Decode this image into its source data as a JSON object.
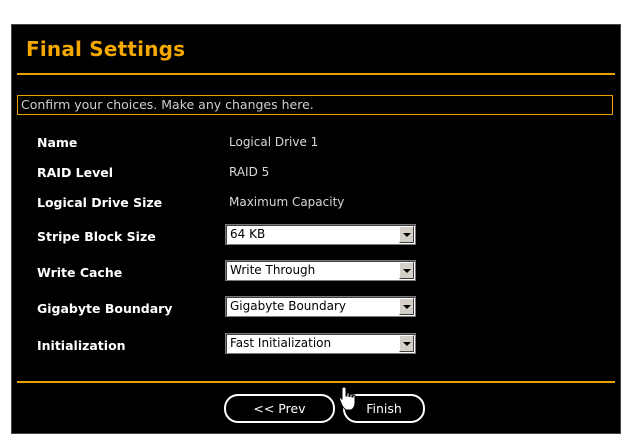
{
  "title": "Final Settings",
  "confirm_text": "Confirm your choices. Make any changes here.",
  "fields": {
    "name": {
      "label": "Name",
      "value": "Logical Drive 1"
    },
    "raid_level": {
      "label": "RAID Level",
      "value": "RAID 5"
    },
    "drive_size": {
      "label": "Logical Drive Size",
      "value": "Maximum Capacity"
    },
    "stripe_block_size": {
      "label": "Stripe Block Size",
      "selected": "64 KB"
    },
    "write_cache": {
      "label": "Write Cache",
      "selected": "Write Through"
    },
    "gigabyte_boundary": {
      "label": "Gigabyte Boundary",
      "selected": "Gigabyte Boundary"
    },
    "initialization": {
      "label": "Initialization",
      "selected": "Fast Initialization"
    }
  },
  "buttons": {
    "prev": "<< Prev",
    "finish": "Finish"
  },
  "colors": {
    "accent": "#e6a000",
    "background": "#000000",
    "text": "#ffffff"
  },
  "icons": {
    "cursor": "hand-pointer-icon",
    "dropdown": "chevron-down-icon"
  }
}
